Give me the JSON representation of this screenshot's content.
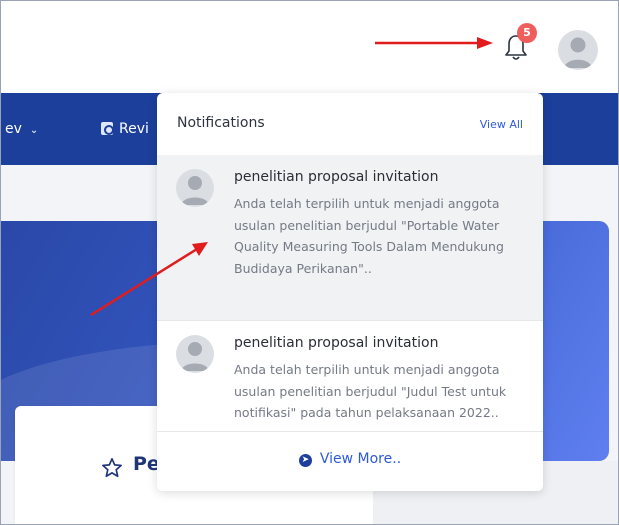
{
  "topbar": {
    "notification_count": "5",
    "bell_icon": "bell-icon",
    "avatar_icon": "user-avatar-icon"
  },
  "navbar": {
    "items": [
      {
        "label": "ev",
        "icon": "chevron-down-icon"
      },
      {
        "label": "Revi",
        "icon": "review-document-icon"
      }
    ]
  },
  "card": {
    "title": "Pe",
    "icon": "star-outline-icon"
  },
  "notifications": {
    "title": "Notifications",
    "view_all": "View All",
    "items": [
      {
        "heading": "penelitian proposal invitation",
        "body": "Anda telah terpilih untuk menjadi anggota usulan penelitian berjudul \"Portable Water Quality Measuring Tools Dalam Mendukung Budidaya Perikanan\".."
      },
      {
        "heading": "penelitian proposal invitation",
        "body": "Anda telah terpilih untuk menjadi anggota usulan penelitian berjudul \"Judul Test untuk notifikasi\" pada tahun pelaksanaan 2022.."
      }
    ],
    "view_more": "View More.."
  },
  "colors": {
    "navbar": "#1b3f9a",
    "accent": "#2d5bd8",
    "badge": "#ef5d5d",
    "annotation_arrow": "#e21c1c"
  }
}
